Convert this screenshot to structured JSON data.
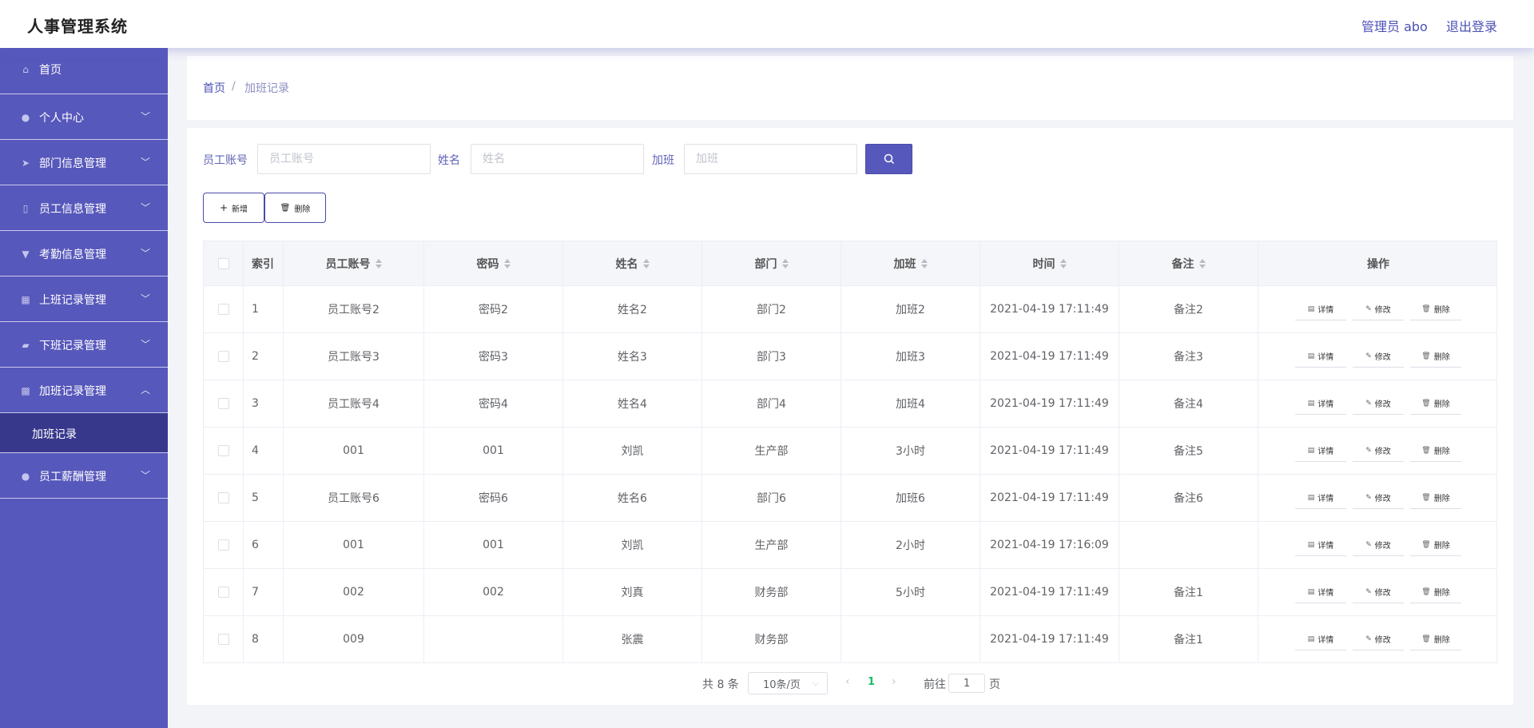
{
  "header": {
    "title": "人事管理系统",
    "admin": "管理员 abo",
    "logout": "退出登录"
  },
  "sidebar": {
    "items": [
      {
        "label": "首页",
        "icon": "home-icon"
      },
      {
        "label": "个人中心",
        "icon": "user-icon"
      },
      {
        "label": "部门信息管理",
        "icon": "send-icon"
      },
      {
        "label": "员工信息管理",
        "icon": "phone-icon"
      },
      {
        "label": "考勤信息管理",
        "icon": "stamp-icon"
      },
      {
        "label": "上班记录管理",
        "icon": "grid-icon"
      },
      {
        "label": "下班记录管理",
        "icon": "thumb-icon"
      },
      {
        "label": "加班记录管理",
        "icon": "apps-icon"
      },
      {
        "label": "员工薪酬管理",
        "icon": "user-icon"
      }
    ],
    "sub_item": "加班记录"
  },
  "breadcrumb": {
    "home": "首页",
    "separator": "/",
    "current": "加班记录"
  },
  "search": {
    "account_label": "员工账号",
    "account_placeholder": "员工账号",
    "name_label": "姓名",
    "name_placeholder": "姓名",
    "overtime_label": "加班",
    "overtime_placeholder": "加班"
  },
  "actions": {
    "add": "新增",
    "delete": "删除"
  },
  "table": {
    "headers": [
      "索引",
      "员工账号",
      "密码",
      "姓名",
      "部门",
      "加班",
      "时间",
      "备注",
      "操作"
    ],
    "rows": [
      [
        "1",
        "员工账号2",
        "密码2",
        "姓名2",
        "部门2",
        "加班2",
        "2021-04-19 17:11:49",
        "备注2"
      ],
      [
        "2",
        "员工账号3",
        "密码3",
        "姓名3",
        "部门3",
        "加班3",
        "2021-04-19 17:11:49",
        "备注3"
      ],
      [
        "3",
        "员工账号4",
        "密码4",
        "姓名4",
        "部门4",
        "加班4",
        "2021-04-19 17:11:49",
        "备注4"
      ],
      [
        "4",
        "001",
        "001",
        "刘凯",
        "生产部",
        "3小时",
        "2021-04-19 17:11:49",
        "备注5"
      ],
      [
        "5",
        "员工账号6",
        "密码6",
        "姓名6",
        "部门6",
        "加班6",
        "2021-04-19 17:11:49",
        "备注6"
      ],
      [
        "6",
        "001",
        "001",
        "刘凯",
        "生产部",
        "2小时",
        "2021-04-19 17:16:09",
        ""
      ],
      [
        "7",
        "002",
        "002",
        "刘真",
        "财务部",
        "5小时",
        "2021-04-19 17:11:49",
        "备注1"
      ],
      [
        "8",
        "009",
        "",
        "张震",
        "财务部",
        "",
        "2021-04-19 17:11:49",
        "备注1"
      ]
    ],
    "row_actions": {
      "detail": "详情",
      "edit": "修改",
      "delete": "删除"
    }
  },
  "pagination": {
    "total": "共 8 条",
    "page_size": "10条/页",
    "current_page": "1",
    "goto_label": "前往",
    "goto_value": "1",
    "goto_unit": "页"
  },
  "colors": {
    "primary": "#5758bb",
    "sidebar_active": "#37388c",
    "link": "#4b50b5",
    "page_active": "#19be6b"
  }
}
